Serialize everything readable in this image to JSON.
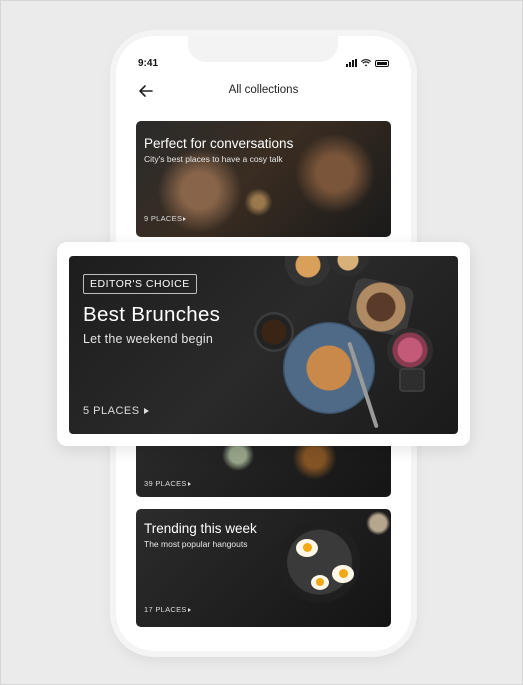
{
  "status_bar": {
    "time": "9:41"
  },
  "nav": {
    "title": "All collections"
  },
  "collections": [
    {
      "title": "Perfect for conversations",
      "subtitle": "City's best places to have a cosy talk",
      "places": "9 PLACES"
    },
    {
      "badge": "EDITOR'S CHOICE",
      "title": "Best Brunches",
      "subtitle": "Let the weekend begin",
      "places": "5 PLACES"
    },
    {
      "places": "39 PLACES"
    },
    {
      "title": "Trending this week",
      "subtitle": "The most popular hangouts",
      "places": "17 PLACES"
    }
  ]
}
